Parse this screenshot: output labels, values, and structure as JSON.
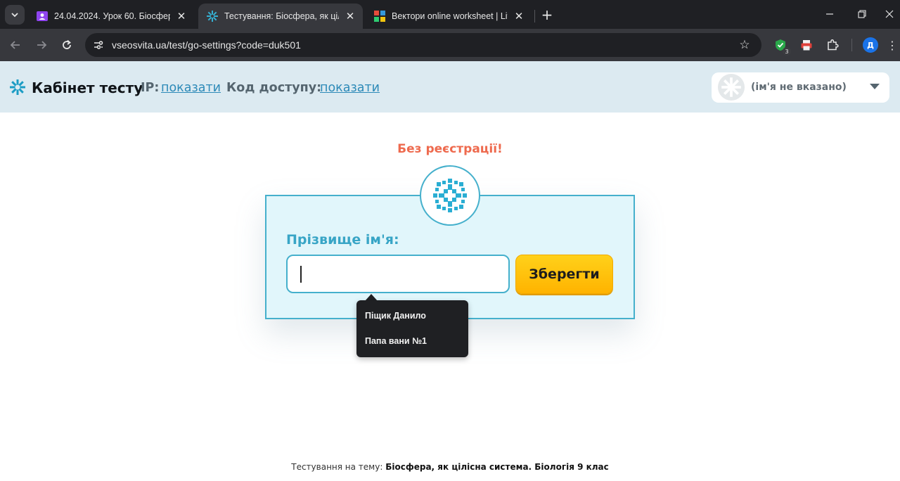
{
  "browser": {
    "tabs": [
      {
        "title": "24.04.2024. Урок 60. Біосфера як",
        "favicon": "classroom-icon",
        "active": false
      },
      {
        "title": "Тестування: Біосфера, як цілісна",
        "favicon": "vseosvita-icon",
        "active": true
      },
      {
        "title": "Вектори online worksheet | Live",
        "favicon": "liveworksheets-icon",
        "active": false
      }
    ],
    "url": "vseosvita.ua/test/go-settings?code=duk501",
    "extension_badge": "3",
    "profile_initial": "Д"
  },
  "header": {
    "brand": "Кабінет тесту",
    "ip_label": "IP:",
    "ip_link": "показати",
    "code_label": "Код доступу:",
    "code_link": "показати",
    "user_name": "(ім'я не вказано)"
  },
  "main": {
    "no_registration": "Без реєстрації!",
    "field_label": "Прізвище ім'я:",
    "input_value": "",
    "save_button": "Зберегти",
    "autocomplete": [
      "Піщик Данило",
      "Папа вани №1"
    ]
  },
  "footer": {
    "prefix": "Тестування на тему:",
    "topic": "Біосфера, як цілісна система. Біологія 9 клас"
  },
  "colors": {
    "accent": "#45b0cc",
    "header_bg": "#dceaf1",
    "warning": "#ee6a4e",
    "button": "#ffc107"
  }
}
